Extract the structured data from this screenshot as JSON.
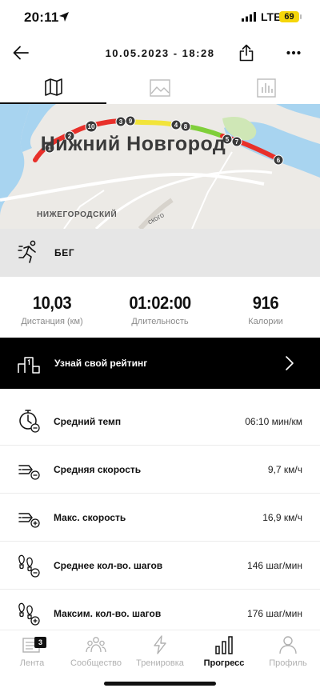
{
  "status_bar": {
    "time": "20:11",
    "network": "LTE",
    "battery": "69"
  },
  "header": {
    "title": "10.05.2023 - 18:28"
  },
  "tabs": [
    {
      "name": "map",
      "icon": "map-icon",
      "active": true
    },
    {
      "name": "photos",
      "icon": "image-icon",
      "active": false
    },
    {
      "name": "charts",
      "icon": "bar-chart-icon",
      "active": false
    }
  ],
  "map": {
    "city": "Нижний Новгород",
    "district": "НИЖЕГОРОДСКИЙ",
    "street_fragment": "ского",
    "markers": [
      "1",
      "2",
      "10",
      "3",
      "9",
      "4",
      "8",
      "5",
      "7",
      "6"
    ]
  },
  "activity": {
    "label": "БЕГ",
    "icon": "running-icon"
  },
  "stats": {
    "distance": {
      "value": "10,03",
      "label": "Дистанция (км)"
    },
    "duration": {
      "value": "01:02:00",
      "label": "Длительность"
    },
    "calories": {
      "value": "916",
      "label": "Калории"
    }
  },
  "ranking": {
    "label": "Узнай свой рейтинг"
  },
  "metrics": [
    {
      "label": "Средний темп",
      "value": "06:10 мин/км",
      "icon": "stopwatch-icon"
    },
    {
      "label": "Средняя скорость",
      "value": "9,7 км/ч",
      "icon": "speed-avg-icon"
    },
    {
      "label": "Макс. скорость",
      "value": "16,9 км/ч",
      "icon": "speed-max-icon"
    },
    {
      "label": "Среднее кол-во. шагов",
      "value": "146 шаг/мин",
      "icon": "footsteps-avg-icon"
    },
    {
      "label": "Максим. кол-во. шагов",
      "value": "176 шаг/мин",
      "icon": "footsteps-max-icon"
    }
  ],
  "bottom_nav": {
    "items": [
      {
        "label": "Лента",
        "badge": "3",
        "active": false
      },
      {
        "label": "Сообщество",
        "active": false
      },
      {
        "label": "Тренировка",
        "active": false
      },
      {
        "label": "Прогресс",
        "active": true
      },
      {
        "label": "Профиль",
        "active": false
      }
    ]
  },
  "colors": {
    "accent": "#000000",
    "route_red": "#e8302a",
    "route_yellow": "#f2e43a",
    "route_green": "#7fcf3a",
    "water": "#a8d4f0",
    "battery": "#f5d60a"
  }
}
